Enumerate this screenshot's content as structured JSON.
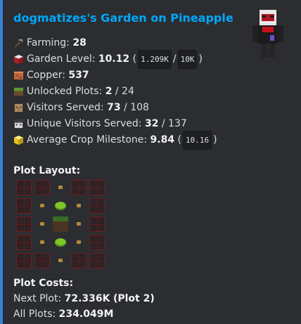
{
  "embed": {
    "title": "dogmatizes's Garden on Pineapple",
    "accent_color": "#3b82d6"
  },
  "stats": {
    "farming": {
      "label": "Farming:",
      "value": "28",
      "icon": "hoe-icon"
    },
    "garden_level": {
      "label": "Garden Level:",
      "value": "10.12",
      "progress_current": "1.209K",
      "progress_separator": "/",
      "progress_max": "10K",
      "icon": "red-block-icon"
    },
    "copper": {
      "label": "Copper:",
      "value": "537",
      "icon": "copper-block-icon"
    },
    "unlocked_plots": {
      "label": "Unlocked Plots:",
      "value": "2",
      "total": "/ 24",
      "icon": "grass-block-icon"
    },
    "visitors_served": {
      "label": "Visitors Served:",
      "value": "73",
      "total": "/ 108",
      "icon": "villager-head-icon"
    },
    "unique_visitors": {
      "label": "Unique Visitors Served:",
      "value": "32",
      "total": "/ 137",
      "icon": "villager-head-icon"
    },
    "crop_milestone": {
      "label": "Average Crop Milestone:",
      "value": "9.84",
      "exact": "10.16",
      "icon": "gold-block-icon"
    }
  },
  "plot_layout": {
    "heading": "Plot Layout:",
    "rows": [
      [
        "locked",
        "locked",
        "seed",
        "locked",
        "locked"
      ],
      [
        "locked",
        "seed",
        "crop",
        "seed",
        "locked"
      ],
      [
        "locked",
        "seed",
        "center",
        "seed",
        "locked"
      ],
      [
        "locked",
        "seed",
        "crop",
        "seed",
        "locked"
      ],
      [
        "locked",
        "locked",
        "seed",
        "locked",
        "locked"
      ]
    ]
  },
  "plot_costs": {
    "heading": "Plot Costs:",
    "next_label": "Next Plot:",
    "next_value": "72.336K",
    "next_plot": "(Plot 2)",
    "all_label": "All Plots:",
    "all_value": "234.049M"
  }
}
